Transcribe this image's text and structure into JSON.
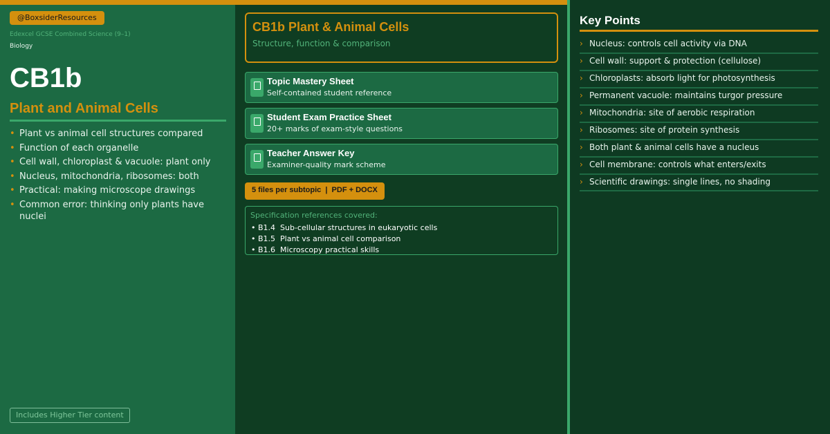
{
  "left": {
    "handle": "@BoxsiderResources",
    "spec": "Edexcel GCSE Combined Science (9–1)",
    "subject": "Biology",
    "code": "CB1b",
    "title": "Plant and Animal Cells",
    "bullets": [
      "Plant vs animal cell structures compared",
      "Function of each organelle",
      "Cell wall, chloroplast & vacuole: plant only",
      "Nucleus, mitochondria, ribosomes: both",
      "Practical: making microscope drawings",
      "Common error: thinking only plants have nuclei"
    ],
    "tier_note": "Includes Higher Tier content"
  },
  "middle": {
    "header_title": "CB1b Plant & Animal Cells",
    "header_subtitle": "Structure, function & comparison",
    "cards": [
      {
        "title": "Topic Mastery Sheet",
        "desc": "Self-contained student reference",
        "icon": "document-icon"
      },
      {
        "title": "Student Exam Practice Sheet",
        "desc": "20+ marks of exam-style questions",
        "icon": "document-icon"
      },
      {
        "title": "Teacher Answer Key",
        "desc": "Examiner-quality mark scheme",
        "icon": "document-icon"
      }
    ],
    "files_badge": "5 files per subtopic  |  PDF + DOCX",
    "refs_heading": "Specification references covered:",
    "refs": [
      "• B1.4  Sub-cellular structures in eukaryotic cells",
      "• B1.5  Plant vs animal cell comparison",
      "• B1.6  Microscopy practical skills"
    ]
  },
  "right": {
    "title": "Key Points",
    "points": [
      "Nucleus: controls cell activity via DNA",
      "Cell wall: support & protection (cellulose)",
      "Chloroplasts: absorb light for photosynthesis",
      "Permanent vacuole: maintains turgor pressure",
      "Mitochondria: site of aerobic respiration",
      "Ribosomes: site of protein synthesis",
      "Both plant & animal cells have a nucleus",
      "Cell membrane: controls what enters/exits",
      "Scientific drawings: single lines, no shading"
    ]
  },
  "glyphs": {
    "bullet": "•",
    "chevron": "›"
  },
  "colors": {
    "accent_orange": "#d4900e",
    "accent_green": "#3aa86a",
    "panel_green": "#1c6a43",
    "dark_green": "#0f3d22"
  }
}
